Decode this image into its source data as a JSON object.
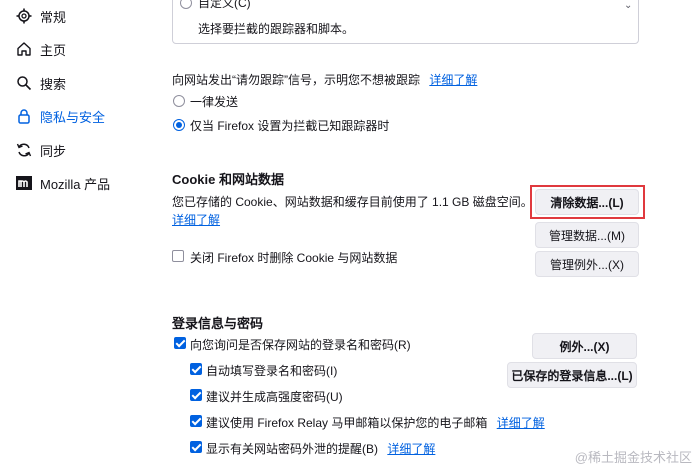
{
  "sidebar": {
    "items": [
      {
        "label": "常规",
        "icon": "gear-icon"
      },
      {
        "label": "主页",
        "icon": "home-icon"
      },
      {
        "label": "搜索",
        "icon": "search-icon"
      },
      {
        "label": "隐私与安全",
        "icon": "lock-icon",
        "active": true
      },
      {
        "label": "同步",
        "icon": "sync-icon"
      },
      {
        "label": "Mozilla 产品",
        "icon": "mozilla-logo-icon"
      }
    ]
  },
  "tracking": {
    "custom_label": "自定义(C)",
    "custom_desc": "选择要拦截的跟踪器和脚本。",
    "dnt_text": "向网站发出“请勿跟踪”信号，示明您不想被跟踪",
    "learn_more": "详细了解",
    "options": [
      {
        "label": "一律发送",
        "selected": false
      },
      {
        "label": "仅当 Firefox 设置为拦截已知跟踪器时",
        "selected": true
      }
    ]
  },
  "cookies": {
    "heading": "Cookie 和网站数据",
    "usage_text": "您已存储的 Cookie、网站数据和缓存目前使用了 1.1 GB 磁盘空间。",
    "learn_more": "详细了解",
    "clear_button": "清除数据...(L)",
    "manage_button": "管理数据...(M)",
    "exceptions_button": "管理例外...(X)",
    "delete_on_close_label": "关闭 Firefox 时删除 Cookie 与网站数据",
    "delete_on_close_checked": false
  },
  "logins": {
    "heading": "登录信息与密码",
    "ask_to_save_label": "向您询问是否保存网站的登录名和密码(R)",
    "autofill_label": "自动填写登录名和密码(I)",
    "suggest_strong_label": "建议并生成高强度密码(U)",
    "relay_label": "建议使用 Firefox Relay 马甲邮箱以保护您的电子邮箱",
    "relay_learn_more": "详细了解",
    "breach_alerts_label": "显示有关网站密码外泄的提醒(B)",
    "breach_learn_more": "详细了解",
    "exceptions_button": "例外...(X)",
    "saved_logins_button": "已保存的登录信息...(L)"
  },
  "watermark": "@稀土掘金技术社区",
  "colors": {
    "accent": "#0061e0",
    "highlight": "#e0393e"
  }
}
